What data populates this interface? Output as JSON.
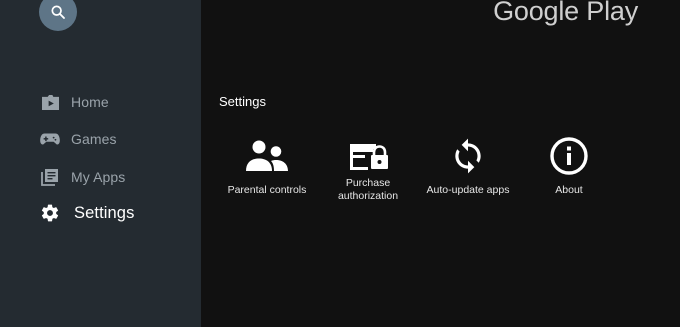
{
  "app": {
    "logo_text": "Google Play"
  },
  "sidebar": {
    "search_icon": "search-icon",
    "items": [
      {
        "label": "Home",
        "icon": "play-folder-icon",
        "active": false
      },
      {
        "label": "Games",
        "icon": "gamepad-icon",
        "active": false
      },
      {
        "label": "My Apps",
        "icon": "apps-library-icon",
        "active": false
      },
      {
        "label": "Settings",
        "icon": "gear-icon",
        "active": true
      }
    ]
  },
  "main": {
    "section_title": "Settings",
    "tiles": [
      {
        "label": "Parental controls",
        "icon": "people-icon"
      },
      {
        "label": "Purchase authorization",
        "icon": "card-lock-icon"
      },
      {
        "label": "Auto-update apps",
        "icon": "sync-icon"
      },
      {
        "label": "About",
        "icon": "info-icon"
      }
    ]
  },
  "colors": {
    "sidebar_bg": "#242b31",
    "main_bg": "#111111",
    "search_button": "#5e7587",
    "inactive_text": "#9aa3aa",
    "active_text": "#ffffff"
  }
}
